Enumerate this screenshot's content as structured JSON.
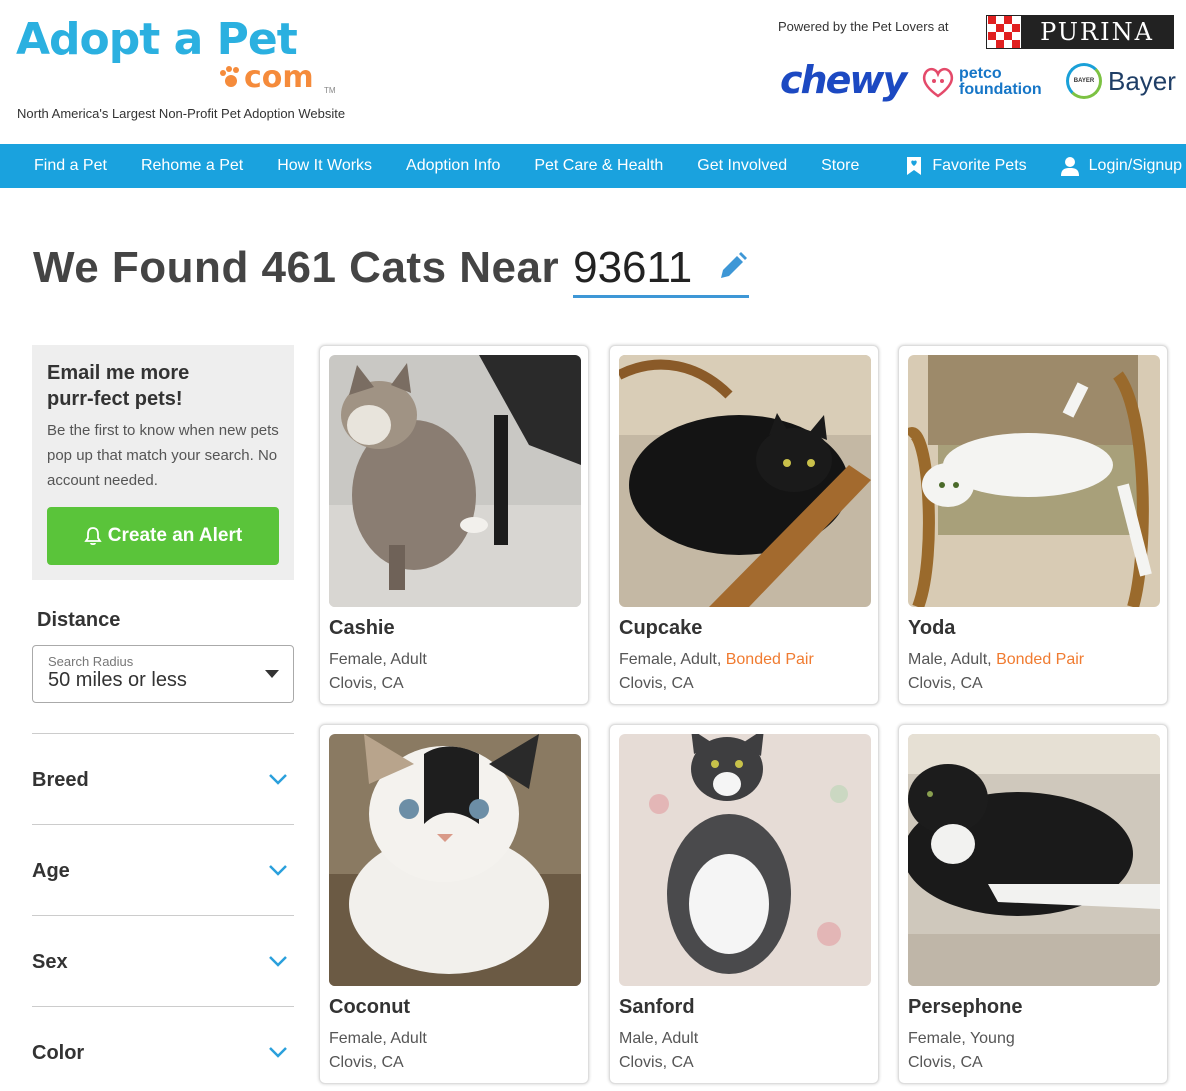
{
  "header": {
    "logo_text": "Adopt a Pet",
    "logo_com": "com",
    "logo_tm": "TM",
    "tagline": "North America's Largest Non-Profit Pet Adoption Website",
    "powered_by": "Powered by the Pet Lovers at",
    "sponsors": {
      "purina": "PURINA",
      "chewy": "chewy",
      "petco_line1": "petco",
      "petco_line2": "foundation",
      "bayer": "Bayer",
      "bayer_seal": "BAYER"
    }
  },
  "nav": {
    "items": [
      "Find a Pet",
      "Rehome a Pet",
      "How It Works",
      "Adoption Info",
      "Pet Care & Health",
      "Get Involved",
      "Store"
    ],
    "favorites": "Favorite Pets",
    "login": "Login/Signup",
    "background": "#1aa2de"
  },
  "search": {
    "heading": "We Found 461 Cats Near",
    "zip": "93611"
  },
  "alert": {
    "title_line1": "Email me more",
    "title_line2": "purr-fect pets!",
    "description": "Be the first to know when new pets pop up that match your search. No account needed.",
    "button": "Create an Alert",
    "button_color": "#5ac43a"
  },
  "distance": {
    "label": "Distance",
    "select_label": "Search Radius",
    "value": "50 miles or less"
  },
  "filters": [
    "Breed",
    "Age",
    "Sex",
    "Color"
  ],
  "pets": [
    {
      "name": "Cashie",
      "details": "Female, Adult",
      "bonded": "",
      "location": "Clovis, CA",
      "icon": "tabby-cat-photo"
    },
    {
      "name": "Cupcake",
      "details": "Female, Adult,",
      "bonded": "Bonded Pair",
      "location": "Clovis, CA",
      "icon": "black-cat-photo"
    },
    {
      "name": "Yoda",
      "details": "Male, Adult,",
      "bonded": "Bonded Pair",
      "location": "Clovis, CA",
      "icon": "white-cat-photo"
    },
    {
      "name": "Coconut",
      "details": "Female, Adult",
      "bonded": "",
      "location": "Clovis, CA",
      "icon": "calico-cat-photo"
    },
    {
      "name": "Sanford",
      "details": "Male, Adult",
      "bonded": "",
      "location": "Clovis, CA",
      "icon": "tuxedo-cat-photo"
    },
    {
      "name": "Persephone",
      "details": "Female, Young",
      "bonded": "",
      "location": "Clovis, CA",
      "icon": "black-white-cat-photo"
    }
  ],
  "colors": {
    "accent": "#1aa2de",
    "bonded": "#f07b30",
    "heading": "#444444"
  }
}
